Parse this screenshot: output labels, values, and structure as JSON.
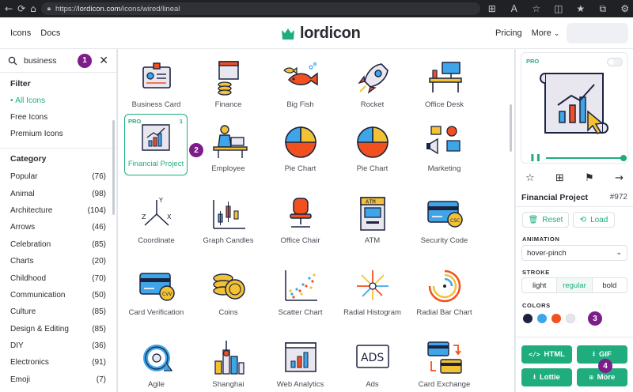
{
  "browser": {
    "url_prefix": "https://",
    "url_host": "lordicon.com",
    "url_path": "/icons/wired/lineal"
  },
  "header": {
    "nav_left": [
      "Icons",
      "Docs"
    ],
    "logo_text": "lordicon",
    "nav_pricing": "Pricing",
    "nav_more": "More"
  },
  "search": {
    "value": "business",
    "badge": "1"
  },
  "filter": {
    "title": "Filter",
    "items": [
      "All Icons",
      "Free Icons",
      "Premium Icons"
    ]
  },
  "category": {
    "title": "Category",
    "items": [
      {
        "name": "Popular",
        "count": "(76)"
      },
      {
        "name": "Animal",
        "count": "(98)"
      },
      {
        "name": "Architecture",
        "count": "(104)"
      },
      {
        "name": "Arrows",
        "count": "(46)"
      },
      {
        "name": "Celebration",
        "count": "(85)"
      },
      {
        "name": "Charts",
        "count": "(20)"
      },
      {
        "name": "Childhood",
        "count": "(70)"
      },
      {
        "name": "Communication",
        "count": "(50)"
      },
      {
        "name": "Culture",
        "count": "(85)"
      },
      {
        "name": "Design & Editing",
        "count": "(85)"
      },
      {
        "name": "DIY",
        "count": "(36)"
      },
      {
        "name": "Electronics",
        "count": "(91)"
      },
      {
        "name": "Emoji",
        "count": "(7)"
      }
    ]
  },
  "grid": {
    "selected_pro": "PRO",
    "selected_num": "1",
    "selected_badge": "2",
    "icons": [
      {
        "label": "Business Card",
        "icon": "business-card-icon"
      },
      {
        "label": "Finance",
        "icon": "finance-icon"
      },
      {
        "label": "Big Fish",
        "icon": "big-fish-icon"
      },
      {
        "label": "Rocket",
        "icon": "rocket-icon"
      },
      {
        "label": "Office Desk",
        "icon": "office-desk-icon"
      },
      {
        "label": "Financial Project",
        "icon": "financial-project-icon"
      },
      {
        "label": "Employee",
        "icon": "employee-icon"
      },
      {
        "label": "Pie Chart",
        "icon": "pie-chart-icon"
      },
      {
        "label": "Pie Chart",
        "icon": "pie-chart-icon"
      },
      {
        "label": "Marketing",
        "icon": "marketing-icon"
      },
      {
        "label": "Coordinate",
        "icon": "coordinate-icon"
      },
      {
        "label": "Graph Candles",
        "icon": "graph-candles-icon"
      },
      {
        "label": "Office Chair",
        "icon": "office-chair-icon"
      },
      {
        "label": "ATM",
        "icon": "atm-icon"
      },
      {
        "label": "Security Code",
        "icon": "security-code-icon"
      },
      {
        "label": "Card Verification",
        "icon": "card-verification-icon"
      },
      {
        "label": "Coins",
        "icon": "coins-icon"
      },
      {
        "label": "Scatter Chart",
        "icon": "scatter-chart-icon"
      },
      {
        "label": "Radial Histogram",
        "icon": "radial-histogram-icon"
      },
      {
        "label": "Radial Bar Chart",
        "icon": "radial-bar-chart-icon"
      },
      {
        "label": "Agile",
        "icon": "agile-icon"
      },
      {
        "label": "Shanghai",
        "icon": "shanghai-icon"
      },
      {
        "label": "Web Analytics",
        "icon": "web-analytics-icon"
      },
      {
        "label": "Ads",
        "icon": "ads-icon"
      },
      {
        "label": "Card Exchange",
        "icon": "card-exchange-icon"
      }
    ],
    "atm_text": "ATM",
    "ads_text": "ADS",
    "csc_text": "CSC",
    "cvv_text": "CVV"
  },
  "panel": {
    "pro": "PRO",
    "title": "Financial Project",
    "id": "#972",
    "reset_label": "Reset",
    "load_label": "Load",
    "animation_label": "ANIMATION",
    "animation_value": "hover-pinch",
    "stroke_label": "STROKE",
    "stroke_options": [
      "light",
      "regular",
      "bold"
    ],
    "colors_label": "COLORS",
    "colors": [
      "#1c2340",
      "#3ea6e8",
      "#f2501e",
      "#e8e6ea"
    ],
    "colors_badge": "3",
    "html_label": "HTML",
    "gif_label": "GIF",
    "lottie_label": "Lottie",
    "more_label": "More",
    "download_badge": "4"
  },
  "colors": {
    "accent": "#1fad7e",
    "badge": "#7c1d8a"
  }
}
